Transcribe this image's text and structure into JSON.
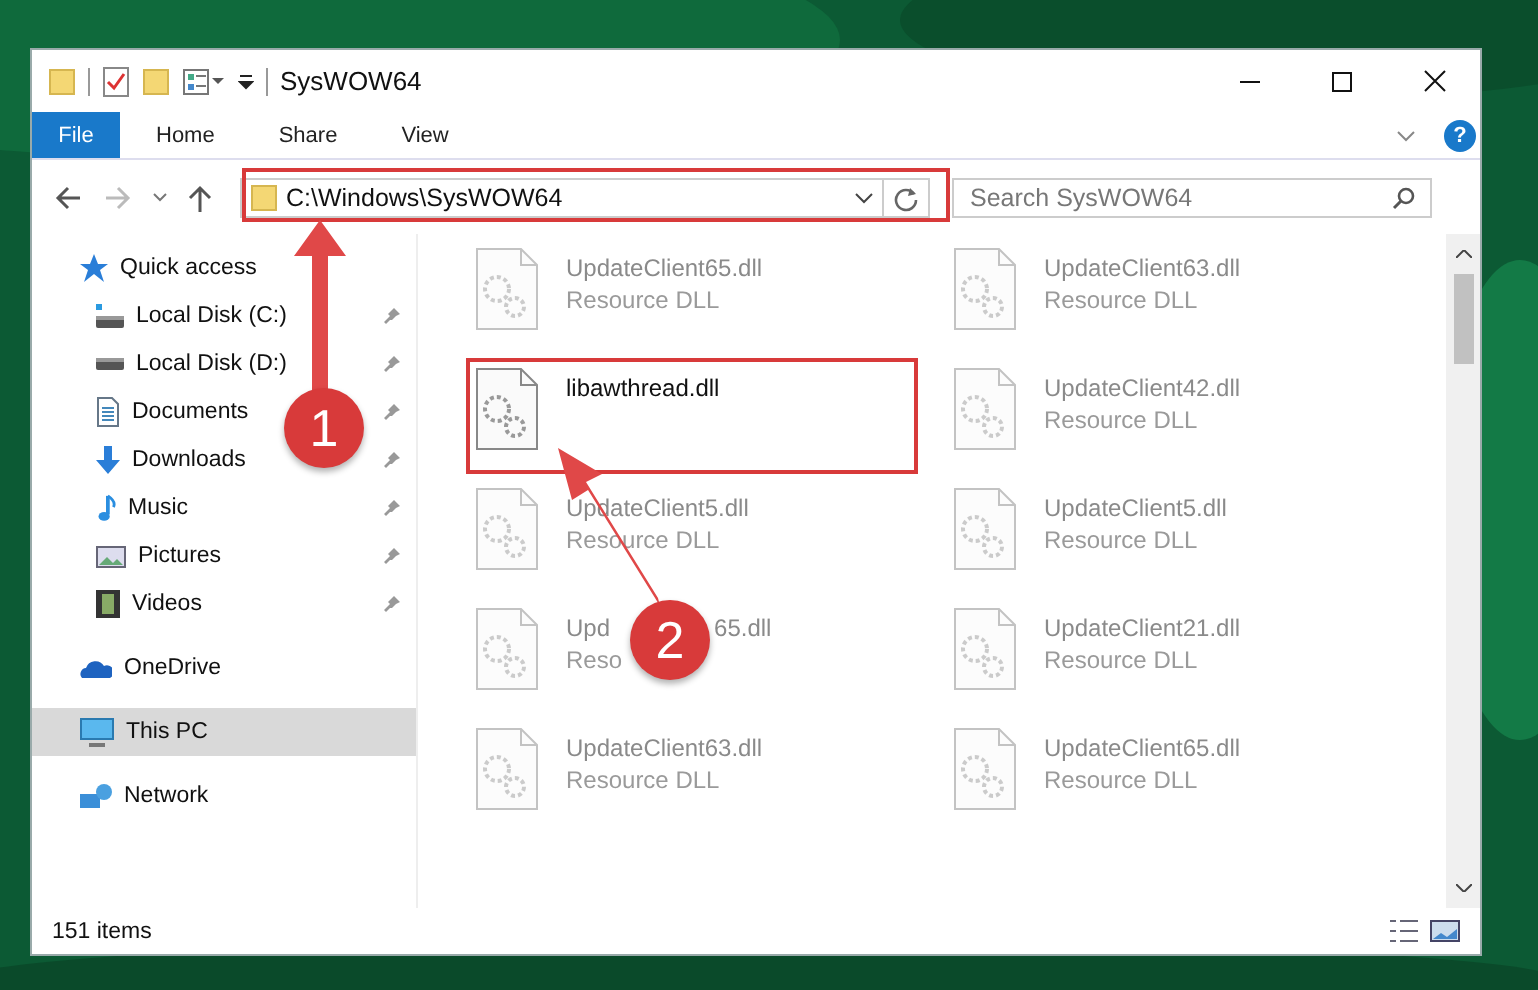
{
  "window": {
    "title": "SysWOW64"
  },
  "ribbon": {
    "tabs": [
      {
        "label": "File",
        "selected": true
      },
      {
        "label": "Home",
        "selected": false
      },
      {
        "label": "Share",
        "selected": false
      },
      {
        "label": "View",
        "selected": false
      }
    ],
    "help": "?"
  },
  "address_bar": {
    "path": "C:\\Windows\\SysWOW64"
  },
  "search": {
    "placeholder": "Search SysWOW64"
  },
  "sidebar": {
    "items": [
      {
        "label": "Quick access",
        "kind": "star",
        "pinned": false,
        "selected": false,
        "children": [
          {
            "label": "Local Disk (C:)",
            "kind": "windrive",
            "pinned": true,
            "selected": false
          },
          {
            "label": "Local Disk (D:)",
            "kind": "drive",
            "pinned": true,
            "selected": false
          },
          {
            "label": "Documents",
            "kind": "documents",
            "pinned": true,
            "selected": false
          },
          {
            "label": "Downloads",
            "kind": "downloads",
            "pinned": true,
            "selected": false
          },
          {
            "label": "Music",
            "kind": "music",
            "pinned": true,
            "selected": false
          },
          {
            "label": "Pictures",
            "kind": "pictures",
            "pinned": true,
            "selected": false
          },
          {
            "label": "Videos",
            "kind": "videos",
            "pinned": true,
            "selected": false
          }
        ]
      },
      {
        "label": "OneDrive",
        "kind": "cloud",
        "pinned": false,
        "selected": false
      },
      {
        "label": "This PC",
        "kind": "pc",
        "pinned": false,
        "selected": true
      },
      {
        "label": "Network",
        "kind": "network",
        "pinned": false,
        "selected": false
      }
    ]
  },
  "files": [
    {
      "name": "UpdateClient65.dll",
      "type": "Resource DLL",
      "dimmed": true,
      "highlighted": false
    },
    {
      "name": "UpdateClient63.dll",
      "type": "Resource DLL",
      "dimmed": true,
      "highlighted": false
    },
    {
      "name": "libawthread.dll",
      "dimmed": false,
      "highlighted": true
    },
    {
      "name": "UpdateClient42.dll",
      "type": "Resource DLL",
      "dimmed": true,
      "highlighted": false
    },
    {
      "name": "UpdateClient5.dll",
      "type": "Resource DLL",
      "dimmed": true,
      "highlighted": false
    },
    {
      "name": "UpdateClient5.dll",
      "type": "Resource DLL",
      "dimmed": true,
      "highlighted": false
    },
    {
      "name": "Upd",
      "name_end": "65.dll",
      "type": "Reso",
      "dimmed": true,
      "highlighted": false
    },
    {
      "name": "UpdateClient21.dll",
      "type": "Resource DLL",
      "dimmed": true,
      "highlighted": false
    },
    {
      "name": "UpdateClient63.dll",
      "type": "Resource DLL",
      "dimmed": true,
      "highlighted": false
    },
    {
      "name": "UpdateClient65.dll",
      "type": "Resource DLL",
      "dimmed": true,
      "highlighted": false
    }
  ],
  "annotations": [
    {
      "label": "1"
    },
    {
      "label": "2"
    }
  ],
  "status_bar": {
    "item_count": "151 items"
  }
}
